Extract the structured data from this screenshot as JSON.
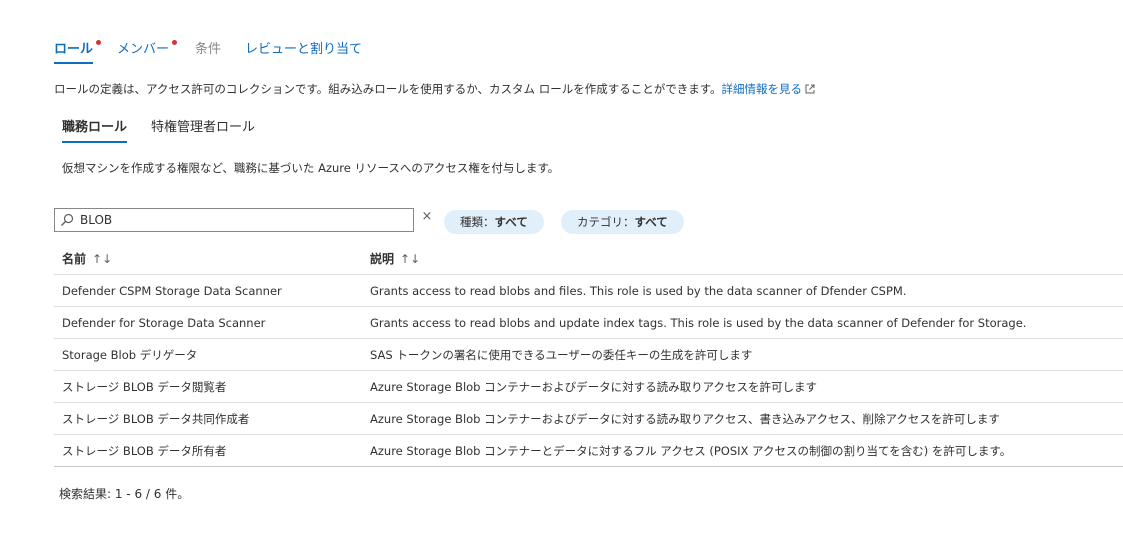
{
  "tabs": {
    "role": "ロール",
    "members": "メンバー",
    "conditions": "条件",
    "review": "レビューと割り当て"
  },
  "intro": {
    "text": "ロールの定義は、アクセス許可のコレクションです。組み込みロールを使用するか、カスタム ロールを作成することができます。",
    "link": "詳細情報を見る"
  },
  "subtabs": {
    "job": "職務ロール",
    "privileged": "特権管理者ロール"
  },
  "job_desc": "仮想マシンを作成する権限など、職務に基づいた Azure リソースへのアクセス権を付与します。",
  "search": {
    "value": "BLOB",
    "clear": "×"
  },
  "filters": {
    "type_label": "種類：",
    "type_value": "すべて",
    "category_label": "カテゴリ：",
    "category_value": "すべて"
  },
  "table": {
    "col_name": "名前",
    "col_desc": "説明",
    "sort_name": "↑↓",
    "sort_desc": "↑↓",
    "rows": [
      {
        "name": "Defender CSPM Storage Data Scanner",
        "desc": "Grants access to read blobs and files. This role is used by the data scanner of Dfender CSPM."
      },
      {
        "name": "Defender for Storage Data Scanner",
        "desc": "Grants access to read blobs and update index tags. This role is used by the data scanner of Defender for Storage."
      },
      {
        "name": "Storage Blob デリゲータ",
        "desc": "SAS トークンの署名に使用できるユーザーの委任キーの生成を許可します"
      },
      {
        "name": "ストレージ BLOB データ閲覧者",
        "desc": "Azure Storage Blob コンテナーおよびデータに対する読み取りアクセスを許可します"
      },
      {
        "name": "ストレージ BLOB データ共同作成者",
        "desc": "Azure Storage Blob コンテナーおよびデータに対する読み取りアクセス、書き込みアクセス、削除アクセスを許可します"
      },
      {
        "name": "ストレージ BLOB データ所有者",
        "desc": "Azure Storage Blob コンテナーとデータに対するフル アクセス (POSIX アクセスの制御の割り当てを含む) を許可します。"
      }
    ]
  },
  "results": "検索結果: 1 - 6 / 6 件。"
}
